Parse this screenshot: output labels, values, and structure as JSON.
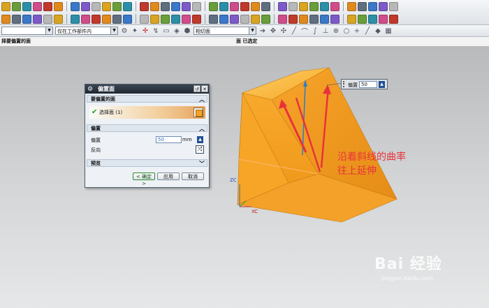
{
  "toolbar_row3": {
    "lock_combo": "",
    "filter_combo": "仅在工作部件内",
    "snap_combo": "相切面"
  },
  "status": {
    "left": "择要偏置的面",
    "center": "面 已选定"
  },
  "dialog": {
    "title": "偏置面",
    "section_face": "要偏置的面",
    "select_face": "选择面 (1)",
    "section_offset": "偏置",
    "offset_label": "偏置",
    "offset_value": "50",
    "offset_unit": "mm",
    "reverse_label": "反向",
    "section_preview": "预览",
    "ok_button": "< 确定 >",
    "apply_button": "应用",
    "cancel_button": "取消"
  },
  "floating_input": {
    "label": "偏置",
    "value": "50"
  },
  "axes": {
    "z": "ZC",
    "x": "XC"
  },
  "annotation": {
    "line1": "沿着斜线的曲率",
    "line2": "往上延伸"
  },
  "watermark": {
    "brand": "Bai 经验",
    "url": "jingyan.baidu.com"
  },
  "colors": {
    "model_face": "#f4a42a",
    "annotation": "#e8323a"
  }
}
